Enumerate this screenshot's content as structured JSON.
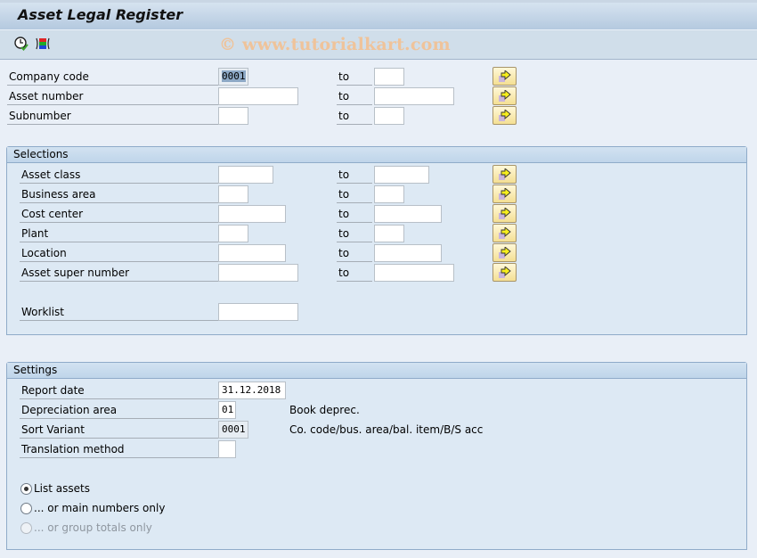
{
  "window": {
    "title": "Asset Legal Register"
  },
  "toolbar": {
    "icons": [
      {
        "name": "execute-clock-icon"
      },
      {
        "name": "selection-options-icon"
      }
    ],
    "watermark": "© www.tutorialkart.com"
  },
  "to_label": "to",
  "header_fields": [
    {
      "label": "Company code",
      "from": "0001",
      "to": ""
    },
    {
      "label": "Asset number",
      "from": "",
      "to": ""
    },
    {
      "label": "Subnumber",
      "from": "",
      "to": ""
    }
  ],
  "selections": {
    "title": "Selections",
    "fields": [
      {
        "label": "Asset class",
        "from": "",
        "to": ""
      },
      {
        "label": "Business area",
        "from": "",
        "to": ""
      },
      {
        "label": "Cost center",
        "from": "",
        "to": ""
      },
      {
        "label": "Plant",
        "from": "",
        "to": ""
      },
      {
        "label": "Location",
        "from": "",
        "to": ""
      },
      {
        "label": "Asset super number",
        "from": "",
        "to": ""
      }
    ],
    "worklist": {
      "label": "Worklist",
      "value": ""
    }
  },
  "settings": {
    "title": "Settings",
    "report_date": {
      "label": "Report date",
      "value": "31.12.2018"
    },
    "depreciation_area": {
      "label": "Depreciation area",
      "value": "01",
      "description": "Book deprec."
    },
    "sort_variant": {
      "label": "Sort Variant",
      "value": "0001",
      "description": "Co. code/bus. area/bal. item/B/S acc"
    },
    "translation_method": {
      "label": "Translation method",
      "value": ""
    },
    "options": [
      {
        "label": "List assets",
        "checked": true,
        "enabled": true
      },
      {
        "label": "... or main numbers only",
        "checked": false,
        "enabled": true
      },
      {
        "label": "... or group totals only",
        "checked": false,
        "enabled": false
      }
    ]
  },
  "colors": {
    "background": "#e9eff7",
    "group_background": "#dde9f4",
    "watermark": "#efc39a",
    "multi_button": "#f4df93"
  }
}
